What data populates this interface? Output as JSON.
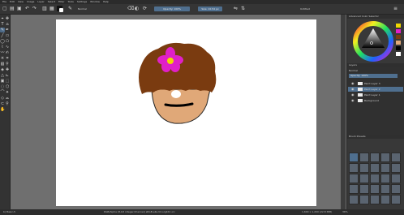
{
  "menu": [
    "File",
    "Edit",
    "View",
    "Image",
    "Layer",
    "Select",
    "Filter",
    "Tools",
    "Settings",
    "Window",
    "Help"
  ],
  "toolbar": {
    "opacity_value": "Opacity: 100%",
    "size_value": "Size: 10.54 px",
    "blend_mode": "Normal",
    "tab_name": "Untitled"
  },
  "dockers": {
    "selector_title": "Advanced Color Selector",
    "layers_title": "Layers",
    "layer_blend": "Normal",
    "layer_opacity": "Opacity: 100%",
    "layers": [
      {
        "name": "Paint Layer 3",
        "selected": false
      },
      {
        "name": "Paint Layer 2",
        "selected": true
      },
      {
        "name": "Paint Layer 1",
        "selected": false
      },
      {
        "name": "Background",
        "selected": false
      }
    ],
    "presets_title": "Brush Presets"
  },
  "status": {
    "left": "b) Basic-5",
    "center": "RGB/Alpha (8-bit integer/channel)  sRGB-elle-V2-srgbtrc.icc",
    "right": "1,600 x 1,200 (22.8 MiB)",
    "zoom": "36%"
  },
  "colors": {
    "accent": "#4f6f8f",
    "hair": "#7a3b10",
    "skin": "#e0a878",
    "flower": "#e020c8",
    "flower_center": "#f0d800"
  }
}
